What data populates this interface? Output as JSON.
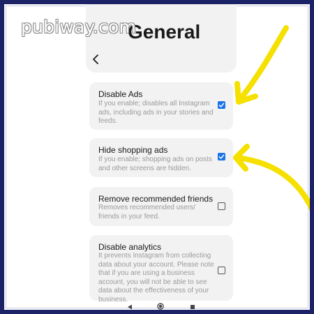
{
  "watermark": "pubiway.com",
  "header": {
    "title": "General",
    "back_icon": "chevron-left-icon"
  },
  "settings": [
    {
      "title": "Disable Ads",
      "description": "If you enable; disables all Instagram ads, including ads in your stories and feeds.",
      "checked": true
    },
    {
      "title": "Hide shopping ads",
      "description": "If you enable; shopping ads on posts and other screens are hidden.",
      "checked": true
    },
    {
      "title": "Remove recommended friends",
      "description": "Removes recommended users/ friends in your feed.",
      "checked": false
    },
    {
      "title": "Disable analytics",
      "description": "It prevents Instagram from collecting data about your account. Please note that if you are using a business account, you will not be able to see data about the effectiveness of your business.",
      "checked": false
    }
  ],
  "nav": {
    "back_icon": "triangle-back-icon",
    "home_icon": "circle-home-icon",
    "recents_icon": "square-recents-icon"
  },
  "colors": {
    "frame": "#1b2266",
    "card": "#f2f2f2",
    "checkbox_on": "#1a73e8",
    "arrow": "#f5e000"
  }
}
